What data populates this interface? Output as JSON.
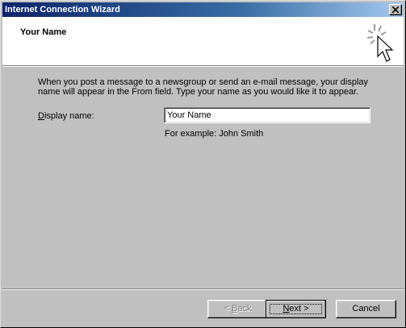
{
  "window": {
    "title": "Internet Connection Wizard"
  },
  "header": {
    "heading": "Your Name"
  },
  "content": {
    "description": "When you post a message to a newsgroup or send an e-mail message, your display name will appear in the From field.  Type your name as you would like it to appear.",
    "display_name_label_accel": "D",
    "display_name_label_rest": "isplay name:",
    "display_name_value": "Your Name",
    "example_text": "For example: John Smith"
  },
  "buttons": {
    "back_prefix": "< ",
    "back_accel": "B",
    "back_rest": "ack",
    "next_accel": "N",
    "next_rest": "ext >",
    "cancel": "Cancel"
  },
  "colors": {
    "titlebar_start": "#0a246a",
    "titlebar_end": "#a6caf0",
    "face": "#c0c0c0",
    "header_bg": "#ffffff",
    "disabled_text": "#808080"
  },
  "icons": {
    "close": "close-icon",
    "wizard": "wizard-sparkle-cursor-icon"
  }
}
